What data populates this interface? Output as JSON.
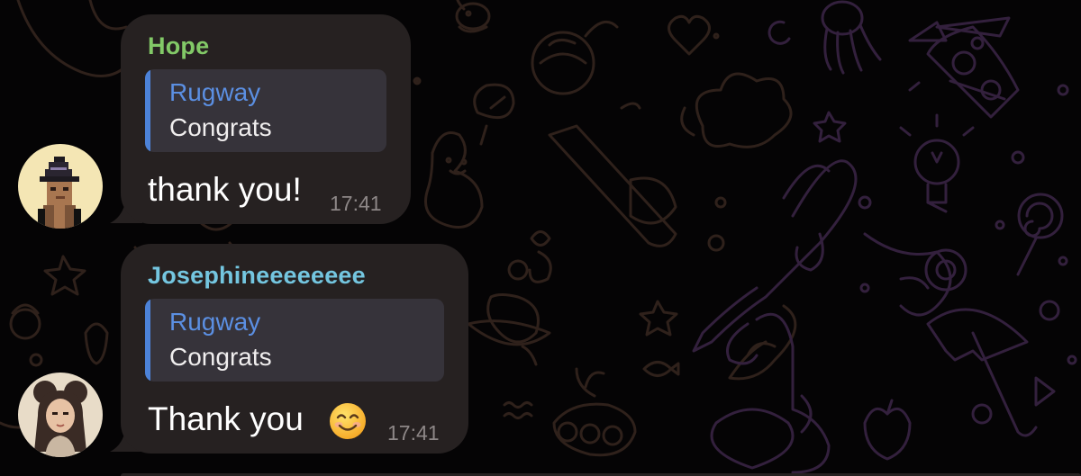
{
  "messages": [
    {
      "sender": "Hope",
      "sender_color": "#82c967",
      "reply_to": {
        "name": "Rugway",
        "text": "Congrats"
      },
      "text": "thank you!",
      "time": "17:41",
      "avatar": "pixel-wizard-avatar"
    },
    {
      "sender": "Josephineeeeeeee",
      "sender_color": "#74c6e0",
      "reply_to": {
        "name": "Rugway",
        "text": "Congrats"
      },
      "text": "Thank you",
      "emoji": "smiling-face-emoji",
      "time": "17:41",
      "avatar": "girl-portrait-avatar"
    }
  ],
  "colors": {
    "background": "#050405",
    "bubble": "#262121",
    "reply_box": "#36333a",
    "reply_accent": "#4c82d8",
    "time": "#8d8787"
  }
}
